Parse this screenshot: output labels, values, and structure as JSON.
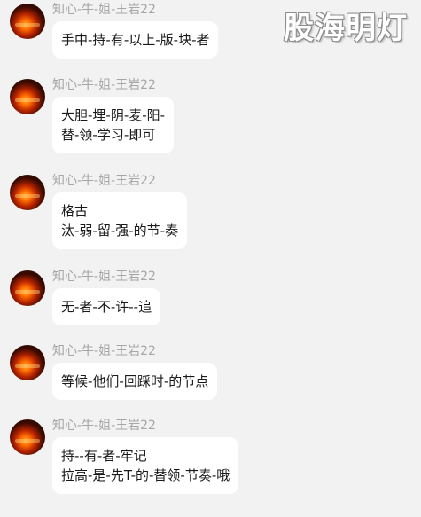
{
  "watermark": "股海明灯",
  "messages": [
    {
      "sender": "知心-牛-姐-王岩22",
      "lines": [
        "手中-持-有-以上-版-块-者"
      ]
    },
    {
      "sender": "知心-牛-姐-王岩22",
      "lines": [
        "大胆-埋-阴-麦-阳-",
        "替-领-学习-即可"
      ]
    },
    {
      "sender": "知心-牛-姐-王岩22",
      "lines": [
        "格古",
        "汰-弱-留-强-的节-奏"
      ]
    },
    {
      "sender": "知心-牛-姐-王岩22",
      "lines": [
        "无-者-不-许--追"
      ]
    },
    {
      "sender": "知心-牛-姐-王岩22",
      "lines": [
        "等候-他们-回踩时-的节点"
      ]
    },
    {
      "sender": "知心-牛-姐-王岩22",
      "lines": [
        "持--有-者-牢记",
        "拉高-是-先T-的-替领-节奏-哦"
      ]
    }
  ]
}
